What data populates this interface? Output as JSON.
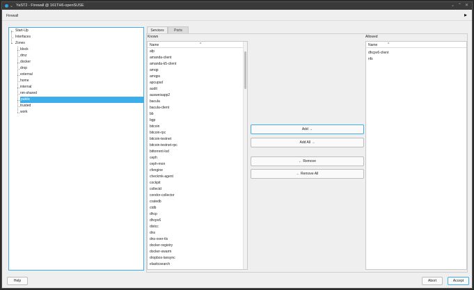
{
  "window": {
    "title": "YaST2 - Firewall @ 161TH6-openSUSE"
  },
  "header": {
    "label": "Firewall"
  },
  "tree": {
    "items": [
      {
        "label": "Start-Up"
      },
      {
        "label": "Interfaces"
      },
      {
        "label": "Zones"
      }
    ],
    "zones": [
      "block",
      "dmz",
      "docker",
      "drop",
      "external",
      "home",
      "internal",
      "nm-shared",
      "public",
      "trusted",
      "work"
    ],
    "selected_zone": "public"
  },
  "tabs": {
    "services": "Services",
    "ports": "Ports"
  },
  "known": {
    "label": "Known",
    "column": "Name",
    "items": [
      "afp",
      "amanda-client",
      "amanda-k5-client",
      "amqp",
      "amqps",
      "apcupsd",
      "audit",
      "ausweisapp2",
      "bacula",
      "bacula-client",
      "bb",
      "bgp",
      "bitcoin",
      "bitcoin-rpc",
      "bitcoin-testnet",
      "bitcoin-testnet-rpc",
      "bittorrent-lsd",
      "ceph",
      "ceph-mon",
      "cfengine",
      "checkmk-agent",
      "cockpit",
      "collectd",
      "condor-collector",
      "cratedb",
      "ctdb",
      "dhcp",
      "dhcpv6",
      "distcc",
      "dns",
      "dns-over-tls",
      "docker-registry",
      "docker-swarm",
      "dropbox-lansync",
      "elasticsearch"
    ]
  },
  "allowed": {
    "label": "Allowed",
    "column": "Name",
    "items": [
      "dhcpv6-client",
      "nfs"
    ]
  },
  "buttons": {
    "add": "Add →",
    "add_all": "Add All →",
    "remove": "← Remove",
    "remove_all": "← Remove All",
    "help": "Help",
    "abort": "Abort",
    "accept": "Accept"
  },
  "colors": {
    "accent": "#3daee9",
    "titlebar": "#3a3a3a",
    "background": "#efefef"
  }
}
